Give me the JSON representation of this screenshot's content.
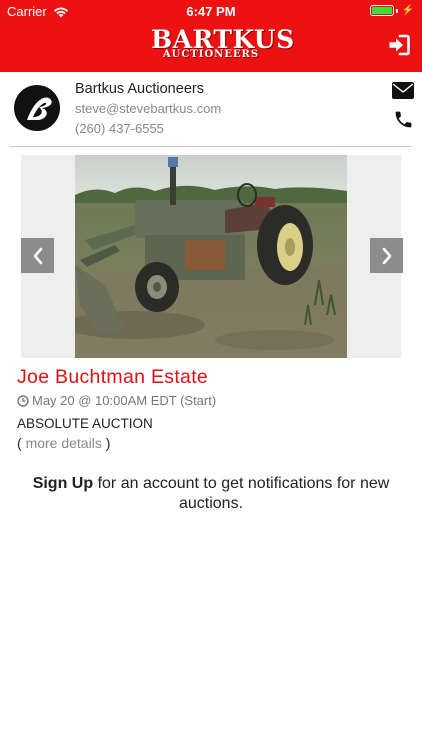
{
  "status_bar": {
    "carrier": "Carrier",
    "time": "6:47 PM",
    "battery_level": 1.0
  },
  "header": {
    "logo_main": "BARTKUS",
    "logo_sub": "AUCTIONEERS",
    "background_color": "#ee1111",
    "login_icon": "sign-in-icon"
  },
  "profile": {
    "name": "Bartkus Auctioneers",
    "email": "steve@stevebartkus.com",
    "phone": "(260) 437-6555",
    "avatar_letter": "B",
    "mail_icon": "envelope-icon",
    "phone_icon": "phone-icon"
  },
  "auction": {
    "title": "Joe Buchtman Estate",
    "date": "May 20 @ 10:00AM EDT (Start)",
    "type": "ABSOLUTE AUCTION",
    "details_open": "(",
    "details_link": "more details",
    "details_close": ")",
    "title_color": "#dd1111",
    "image_icon": "tractor-photo"
  },
  "signup": {
    "link_label": "Sign Up",
    "message": "for an account to get notifications for new auctions."
  }
}
